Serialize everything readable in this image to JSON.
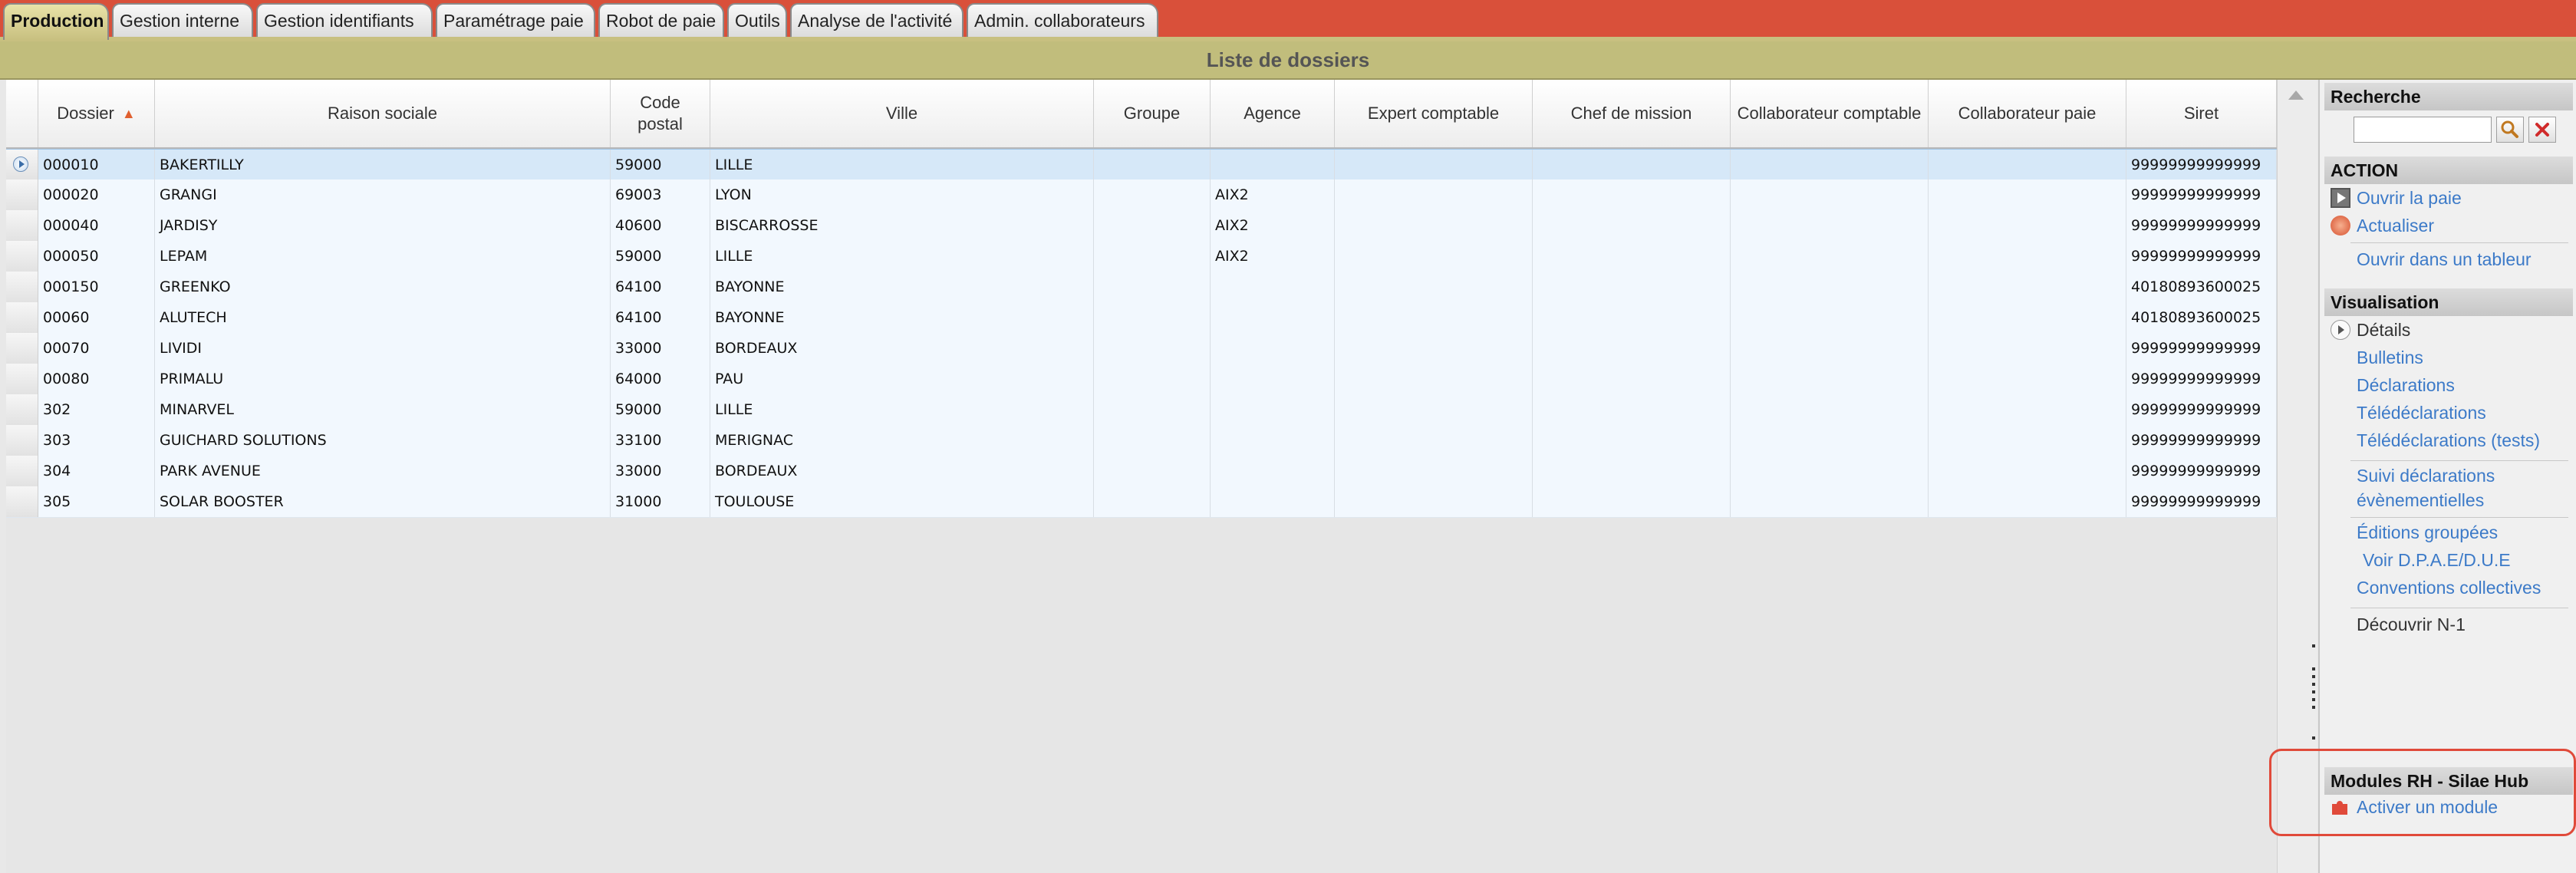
{
  "tabs": [
    {
      "label": "Production",
      "active": true
    },
    {
      "label": "Gestion interne"
    },
    {
      "label": "Gestion identifiants"
    },
    {
      "label": "Paramétrage paie"
    },
    {
      "label": "Robot de paie"
    },
    {
      "label": "Outils"
    },
    {
      "label": "Analyse de l'activité"
    },
    {
      "label": "Admin. collaborateurs"
    }
  ],
  "list_title": "Liste de dossiers",
  "columns": {
    "dossier": "Dossier",
    "raison_sociale": "Raison sociale",
    "code_postal": "Code postal",
    "ville": "Ville",
    "groupe": "Groupe",
    "agence": "Agence",
    "expert_comptable": "Expert comptable",
    "chef_de_mission": "Chef de mission",
    "collaborateur_comptable": "Collaborateur comptable",
    "collaborateur_paie": "Collaborateur paie",
    "siret": "Siret"
  },
  "sort": {
    "column": "dossier",
    "direction": "ascending"
  },
  "rows": [
    {
      "dossier": "000010",
      "raison": "BAKERTILLY",
      "cp": "59000",
      "ville": "LILLE",
      "groupe": "",
      "agence": "",
      "siret": "99999999999999",
      "selected": true
    },
    {
      "dossier": "000020",
      "raison": "GRANGI",
      "cp": "69003",
      "ville": "LYON",
      "groupe": "",
      "agence": "AIX2",
      "siret": "99999999999999"
    },
    {
      "dossier": "000040",
      "raison": "JARDISY",
      "cp": "40600",
      "ville": "BISCARROSSE",
      "groupe": "",
      "agence": "AIX2",
      "siret": "99999999999999"
    },
    {
      "dossier": "000050",
      "raison": "LEPAM",
      "cp": "59000",
      "ville": "LILLE",
      "groupe": "",
      "agence": "AIX2",
      "siret": "99999999999999"
    },
    {
      "dossier": "000150",
      "raison": "GREENKO",
      "cp": "64100",
      "ville": "BAYONNE",
      "groupe": "",
      "agence": "",
      "siret": "40180893600025"
    },
    {
      "dossier": "00060",
      "raison": "ALUTECH",
      "cp": "64100",
      "ville": "BAYONNE",
      "groupe": "",
      "agence": "",
      "siret": "40180893600025"
    },
    {
      "dossier": "00070",
      "raison": "LIVIDI",
      "cp": "33000",
      "ville": "BORDEAUX",
      "groupe": "",
      "agence": "",
      "siret": "99999999999999"
    },
    {
      "dossier": "00080",
      "raison": "PRIMALU",
      "cp": "64000",
      "ville": "PAU",
      "groupe": "",
      "agence": "",
      "siret": "99999999999999"
    },
    {
      "dossier": "302",
      "raison": "MINARVEL",
      "cp": "59000",
      "ville": "LILLE",
      "groupe": "",
      "agence": "",
      "siret": "99999999999999"
    },
    {
      "dossier": "303",
      "raison": "GUICHARD SOLUTIONS",
      "cp": "33100",
      "ville": "MERIGNAC",
      "groupe": "",
      "agence": "",
      "siret": "99999999999999"
    },
    {
      "dossier": "304",
      "raison": "PARK AVENUE",
      "cp": "33000",
      "ville": "BORDEAUX",
      "groupe": "",
      "agence": "",
      "siret": "99999999999999"
    },
    {
      "dossier": "305",
      "raison": "SOLAR BOOSTER",
      "cp": "31000",
      "ville": "TOULOUSE",
      "groupe": "",
      "agence": "",
      "siret": "99999999999999"
    }
  ],
  "panel": {
    "recherche": {
      "title": "Recherche",
      "value": ""
    },
    "action": {
      "title": "ACTION",
      "ouvrir_paie": "Ouvrir la paie",
      "actualiser": "Actualiser",
      "ouvrir_tableur": "Ouvrir dans un tableur"
    },
    "visualisation": {
      "title": "Visualisation",
      "details": "Détails",
      "bulletins": "Bulletins",
      "declarations": "Déclarations",
      "teledeclarations": "Télédéclarations",
      "teledeclarations_tests": "Télédéclarations (tests)",
      "suivi_line1": "Suivi déclarations",
      "suivi_line2": "évènementielles",
      "editions": "Éditions groupées",
      "dpae": "Voir D.P.A.E/D.U.E",
      "conventions": "Conventions collectives",
      "decouvrir": "Découvrir N-1"
    },
    "modules": {
      "title": "Modules RH - Silae Hub",
      "activer": "Activer un module"
    }
  },
  "colors": {
    "tabbar": "#d9503a",
    "header": "#c1bd7c",
    "link": "#3c7ac8",
    "highlight": "#e04a3a"
  }
}
